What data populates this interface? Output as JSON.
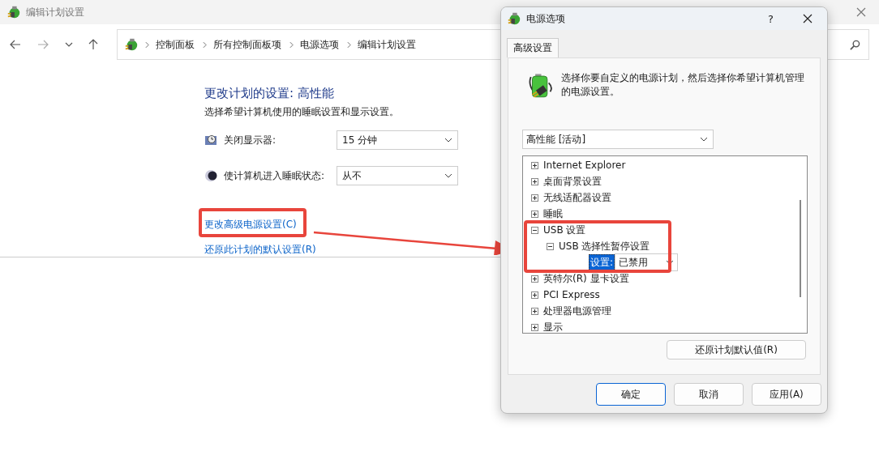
{
  "main_window": {
    "title": "编辑计划设置",
    "breadcrumbs": [
      "控制面板",
      "所有控制面板项",
      "电源选项",
      "编辑计划设置"
    ],
    "heading": "更改计划的设置: 高性能",
    "subheading": "选择希望计算机使用的睡眠设置和显示设置。",
    "settings": [
      {
        "kind": "display",
        "label": "关闭显示器:",
        "value": "15 分钟"
      },
      {
        "kind": "sleep",
        "label": "使计算机进入睡眠状态:",
        "value": "从不"
      }
    ],
    "links": [
      {
        "label": "更改高级电源设置(C)",
        "highlighted": true
      },
      {
        "label": "还原此计划的默认设置(R)",
        "highlighted": false
      }
    ]
  },
  "dialog": {
    "title": "电源选项",
    "help": "?",
    "tabs": [
      {
        "label": "高级设置",
        "selected": true
      }
    ],
    "description": "选择你要自定义的电源计划，然后选择你希望计算机管理的电源设置。",
    "plan": "高性能 [活动]",
    "tree": [
      {
        "label": "Internet Explorer",
        "expanded": false,
        "highlighted": false
      },
      {
        "label": "桌面背景设置",
        "expanded": false,
        "highlighted": false
      },
      {
        "label": "无线适配器设置",
        "expanded": false,
        "highlighted": false
      },
      {
        "label": "睡眠",
        "expanded": false,
        "highlighted": false
      },
      {
        "label": "USB 设置",
        "expanded": true,
        "highlighted": true,
        "children": [
          {
            "label": "USB 选择性暂停设置",
            "expanded": true,
            "highlighted": false,
            "setting": {
              "label": "设置:",
              "value": "已禁用",
              "selected": true
            }
          }
        ]
      },
      {
        "label": "英特尔(R) 显卡设置",
        "expanded": false,
        "highlighted": false
      },
      {
        "label": "PCI Express",
        "expanded": false,
        "highlighted": false
      },
      {
        "label": "处理器电源管理",
        "expanded": false,
        "highlighted": false
      },
      {
        "label": "显示",
        "expanded": false,
        "highlighted": false
      }
    ],
    "restore_button": "还原计划默认值(R)",
    "buttons": [
      {
        "label": "确定",
        "default": true
      },
      {
        "label": "取消",
        "default": false
      },
      {
        "label": "应用(A)",
        "default": false
      }
    ]
  }
}
